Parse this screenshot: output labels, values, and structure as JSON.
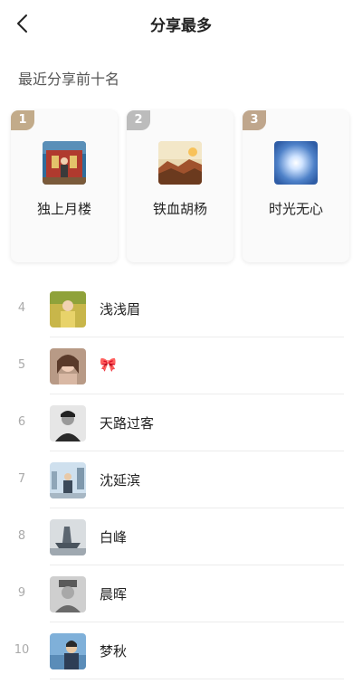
{
  "header": {
    "title": "分享最多"
  },
  "section_title": "最近分享前十名",
  "top3": [
    {
      "rank": "1",
      "name": "独上月楼",
      "badge_color": "#c2ab8a"
    },
    {
      "rank": "2",
      "name": "铁血胡杨",
      "badge_color": "#bcbcbc"
    },
    {
      "rank": "3",
      "name": "时光无心",
      "badge_color": "#bfa68c"
    }
  ],
  "list": [
    {
      "rank": "4",
      "name": "浅浅眉"
    },
    {
      "rank": "5",
      "name": "🎀"
    },
    {
      "rank": "6",
      "name": "天路过客"
    },
    {
      "rank": "7",
      "name": "沈延滨"
    },
    {
      "rank": "8",
      "name": "白峰"
    },
    {
      "rank": "9",
      "name": "晨晖"
    },
    {
      "rank": "10",
      "name": "梦秋"
    }
  ]
}
